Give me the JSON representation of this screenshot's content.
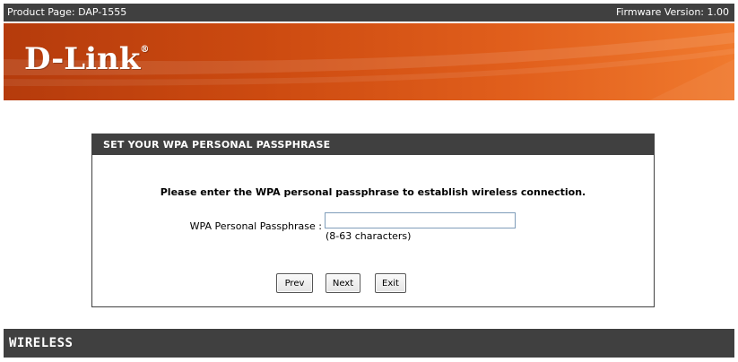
{
  "topbar": {
    "product": "Product Page: DAP-1555",
    "firmware": "Firmware Version: 1.00"
  },
  "header": {
    "logo_text": "D-Link",
    "logo_mark": "®",
    "colors": {
      "start": "#b53b0c",
      "end": "#f07a2e"
    }
  },
  "panel": {
    "title": "SET YOUR WPA PERSONAL PASSPHRASE",
    "instruction": "Please enter the WPA personal passphrase to establish wireless connection.",
    "field_label": "WPA Personal Passphrase :",
    "field_value": "",
    "field_hint": "(8-63 characters)",
    "buttons": {
      "prev": "Prev",
      "next": "Next",
      "exit": "Exit"
    }
  },
  "footer": {
    "brand": "WIRELESS"
  },
  "colors": {
    "bar_bg": "#404040",
    "bar_text": "#ffffff"
  }
}
